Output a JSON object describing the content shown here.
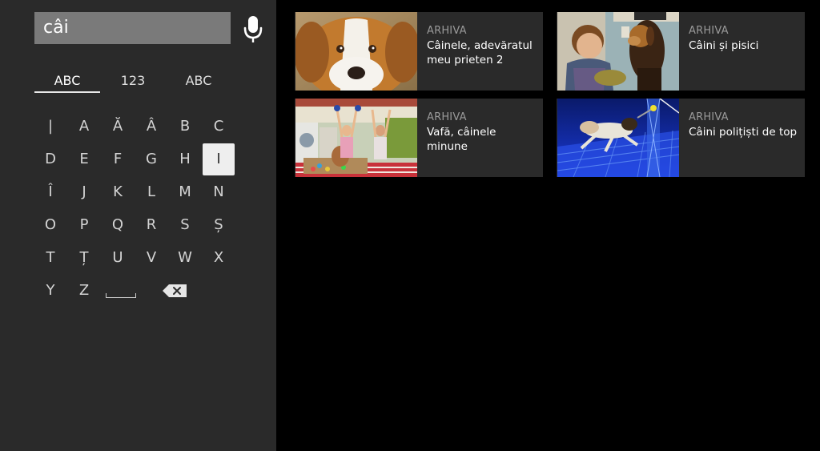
{
  "search": {
    "query": "câi"
  },
  "keyboard": {
    "tabs": [
      "ABC",
      "123",
      "ABC"
    ],
    "active_tab": 0,
    "rows": [
      [
        "|",
        "A",
        "Ă",
        "Â",
        "B",
        "C"
      ],
      [
        "D",
        "E",
        "F",
        "G",
        "H",
        "I"
      ],
      [
        "Î",
        "J",
        "K",
        "L",
        "M",
        "N"
      ],
      [
        "O",
        "P",
        "Q",
        "R",
        "S",
        "Ș"
      ],
      [
        "T",
        "Ț",
        "U",
        "V",
        "W",
        "X"
      ],
      [
        "Y",
        "Z"
      ]
    ],
    "selected_key": "I"
  },
  "results": [
    {
      "category": "ARHIVA",
      "title": "Câinele, adevăratul meu prieten 2",
      "thumbnail": "dog-closeup"
    },
    {
      "category": "ARHIVA",
      "title": "Câini și pisici",
      "thumbnail": "boy-and-dog"
    },
    {
      "category": "ARHIVA",
      "title": "Vafă, câinele minune",
      "thumbnail": "kids-kitchen-dog"
    },
    {
      "category": "ARHIVA",
      "title": "Câini polițiști de top",
      "thumbnail": "police-dog-blue"
    }
  ],
  "colors": {
    "panel_bg": "#2a2a2a",
    "search_field_bg": "#7a7a7a",
    "selected_key_bg": "#eeeeee",
    "card_bg": "#2a2a2a",
    "page_bg": "#000000"
  }
}
